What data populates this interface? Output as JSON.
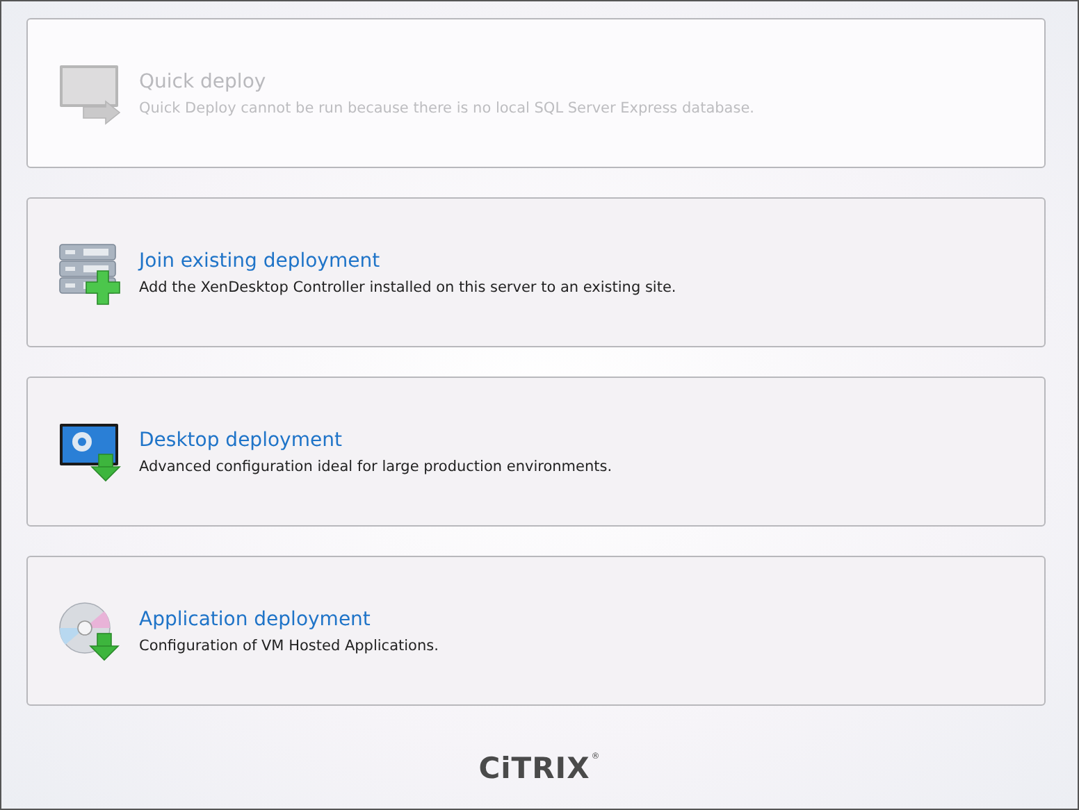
{
  "options": [
    {
      "kind": "monitor",
      "title": "Quick deploy",
      "description": "Quick Deploy cannot be run because there is no local SQL Server Express database.",
      "disabled": true
    },
    {
      "kind": "server",
      "title": "Join existing deployment",
      "description": "Add the XenDesktop Controller installed on this server to an existing site.",
      "disabled": false
    },
    {
      "kind": "desktop",
      "title": "Desktop deployment",
      "description": "Advanced configuration ideal for large production environments.",
      "disabled": false
    },
    {
      "kind": "disc",
      "title": "Application deployment",
      "description": "Configuration of VM Hosted Applications.",
      "disabled": false
    }
  ],
  "logo": {
    "text": "CiTRIX",
    "mark": "®"
  }
}
